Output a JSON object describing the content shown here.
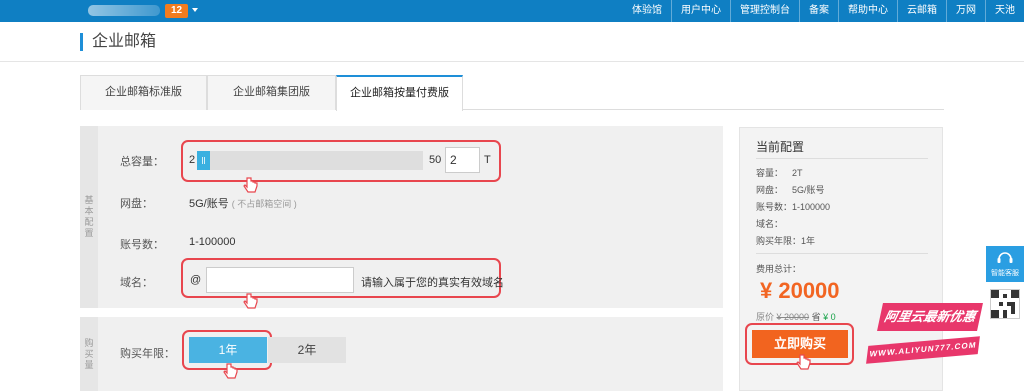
{
  "header": {
    "badge": "12",
    "nav": [
      "体验馆",
      "用户中心",
      "管理控制台",
      "备案",
      "帮助中心",
      "云邮箱",
      "万网",
      "天池"
    ]
  },
  "page": {
    "title": "企业邮箱",
    "tabs": [
      "企业邮箱标准版",
      "企业邮箱集团版",
      "企业邮箱按量付费版"
    ],
    "active_tab": 2
  },
  "config": {
    "section_basic": "基本配置",
    "section_buy": "购买量",
    "capacity": {
      "label": "总容量：",
      "min": "2",
      "max": "50",
      "value": "2",
      "unit": "T",
      "level_fraction": 0.0
    },
    "disk": {
      "label": "网盘：",
      "value": "5G/账号",
      "hint": "( 不占邮箱空间 )"
    },
    "accounts": {
      "label": "账号数：",
      "value": "1-100000"
    },
    "domain": {
      "label": "域名：",
      "prefix": "@",
      "value": "",
      "hint": "请输入属于您的真实有效域名"
    },
    "years": {
      "label": "购买年限：",
      "options": [
        "1年",
        "2年"
      ],
      "selected": 0
    }
  },
  "summary": {
    "title": "当前配置",
    "items": [
      {
        "k": "容量：",
        "v": "2T"
      },
      {
        "k": "网盘：",
        "v": "5G/账号"
      },
      {
        "k": "账号数：",
        "v": "1-100000"
      },
      {
        "k": "域名：",
        "v": ""
      },
      {
        "k": "购买年限：",
        "v": "1年"
      }
    ],
    "total_label": "费用总计：",
    "price": "¥ 20000",
    "orig_label": "原价",
    "orig_price": "¥ 20000",
    "save_label": "省",
    "save_value": "¥ 0",
    "buy_label": "立即购买"
  },
  "promo": {
    "line1": "阿里云最新优惠",
    "line2": "WWW.ALIYUN777.COM"
  },
  "support": {
    "label": "智能客服"
  },
  "colors": {
    "brand_blue": "#0f7fc3",
    "accent_orange": "#f2641f",
    "highlight_red": "#e8464e",
    "slider_blue": "#3ab0e0"
  }
}
